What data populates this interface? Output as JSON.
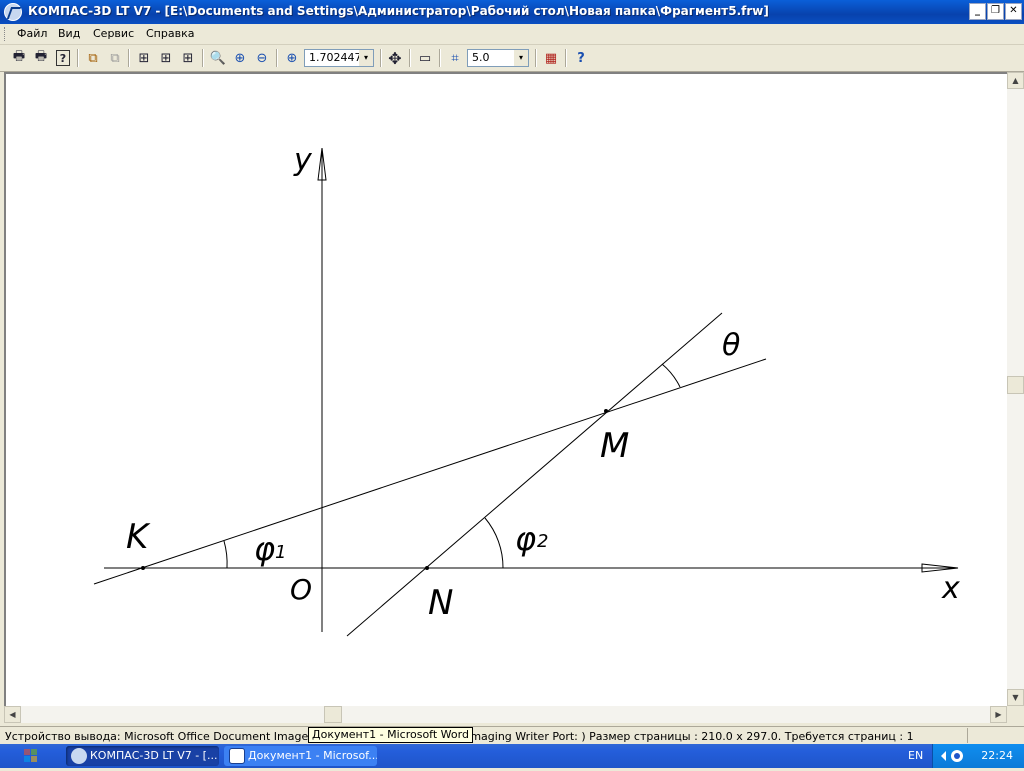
{
  "window": {
    "title": "КОМПАС-3D LT V7 - [E:\\Documents and Settings\\Администратор\\Рабочий стол\\Новая папка\\Фрагмент5.frw]",
    "min_glyph": "_",
    "restore_glyph": "❐",
    "close_glyph": "✕"
  },
  "menu": {
    "file": "Файл",
    "view": "Вид",
    "service": "Сервис",
    "help": "Справка"
  },
  "toolbar": {
    "zoom_value": "1.702447",
    "step_value": "5.0",
    "combo_arrow": "▾",
    "icons": {
      "print": "🖶",
      "print_preview": "🖶",
      "help": "?",
      "copy": "⧉",
      "paste": "⧉",
      "view_a": "⊞",
      "view_b": "⊞",
      "view_c": "⊞",
      "zoom": "🔍",
      "zoom_in": "⊕",
      "zoom_out": "⊖",
      "zoom_scale": "⊕",
      "pan": "✥",
      "refresh": "▭",
      "grid": "⌗",
      "layers": "▦",
      "context_help": "?"
    }
  },
  "drawing": {
    "labels": {
      "y": "y",
      "x": "x",
      "theta": "θ",
      "M": "M",
      "K": "K",
      "N": "N",
      "O": "O",
      "phi": "φ",
      "sub1": "1",
      "sub2": "2"
    }
  },
  "scroll": {
    "up": "▲",
    "down": "▼",
    "left": "◀",
    "right": "▶"
  },
  "statusbar": {
    "text": "Устройство вывода: Microsoft Office Document Image Writer (Microsoft Document Imaging Writer Port: )  Размер страницы : 210.0 x 297.0.  Требуется страниц : 1",
    "tooltip": "Документ1 - Microsoft Word"
  },
  "taskbar": {
    "tasks": [
      {
        "label": "КОМПАС-3D LT V7 - [..."
      },
      {
        "label": "Документ1 - Microsof..."
      }
    ],
    "language": "EN",
    "clock": "22:24"
  },
  "colors": {
    "titlebar": "#0842ad",
    "workspace": "#ffffff",
    "chrome": "#ece9d8",
    "taskbar": "#245edb",
    "tray": "#0c7ad8"
  }
}
